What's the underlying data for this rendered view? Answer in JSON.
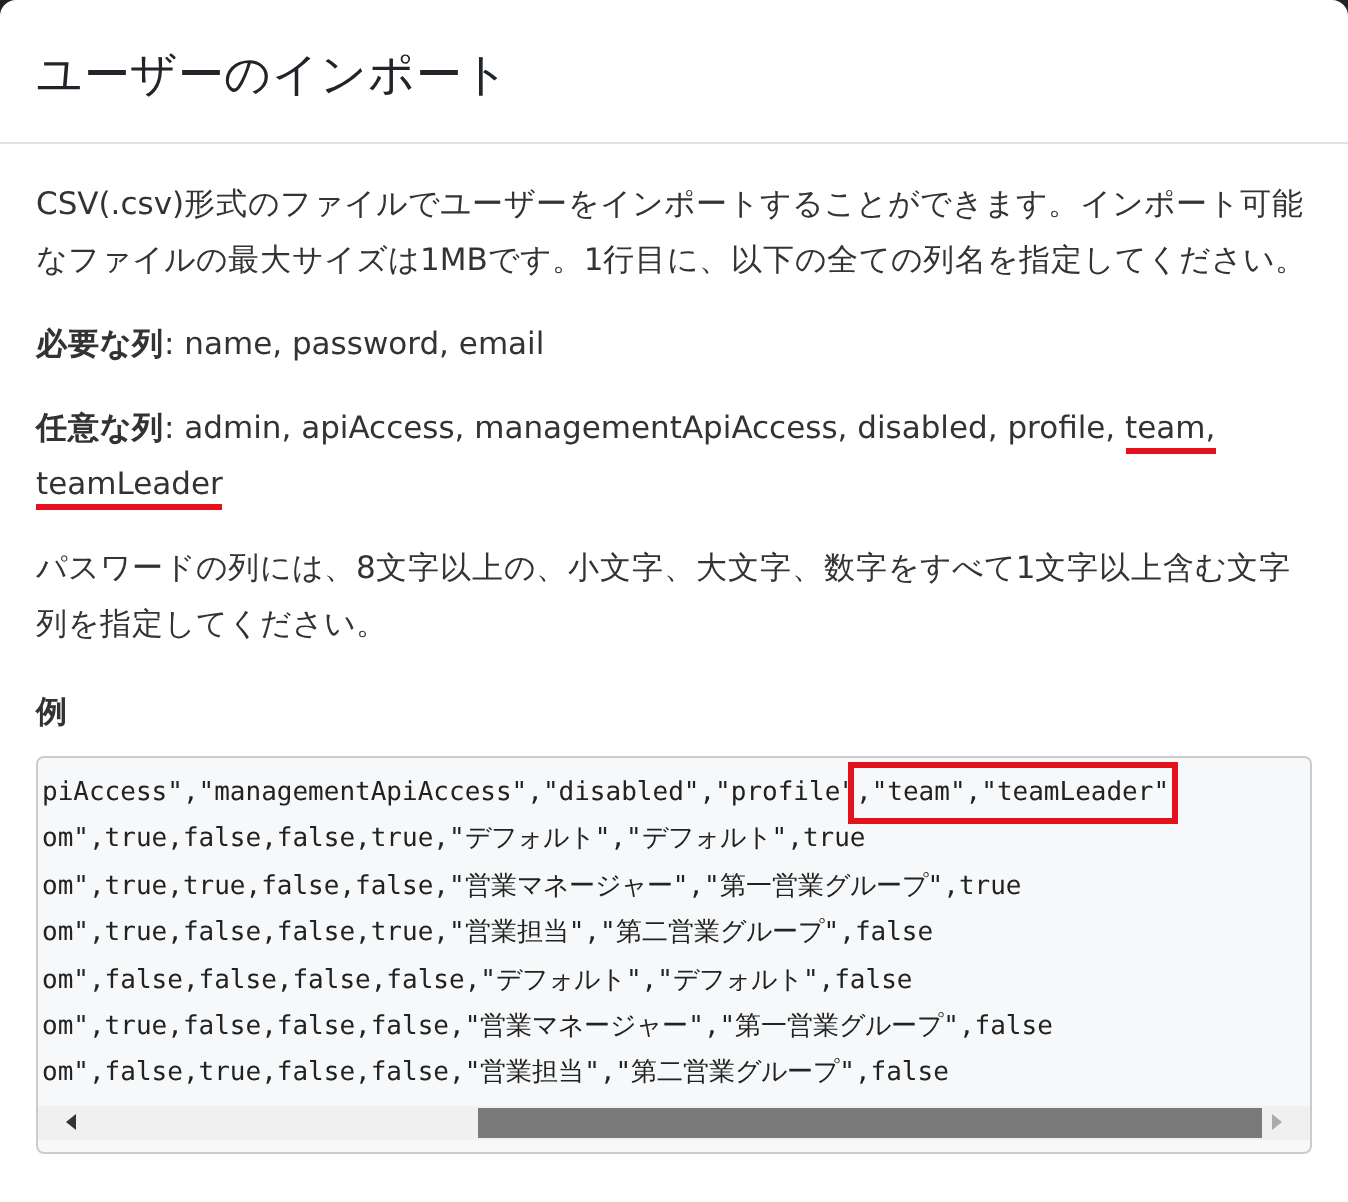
{
  "dialog": {
    "title": "ユーザーのインポート"
  },
  "intro": "CSV(.csv)形式のファイルでユーザーをインポートすることができます。インポート可能なファイルの最大サイズは1MBです。1行目に、以下の全ての列名を指定してください。",
  "required": {
    "label": "必要な列",
    "value": ": name, password, email"
  },
  "optional": {
    "label": "任意な列",
    "parts": [
      {
        "text": ": admin, apiAccess, managementApiAccess, disabled, profile, ",
        "underlined": false
      },
      {
        "text": "team,",
        "underlined": true
      },
      {
        "text": " teamLeader",
        "underlined": true
      }
    ]
  },
  "password_note": "パスワードの列には、8文字以上の、小文字、大文字、数字をすべて1文字以上含む文字列を指定してください。",
  "example": {
    "heading": "例",
    "lines": [
      {
        "text": "piAccess\",\"managementApiAccess\",\"disabled\",\"profile\"",
        "boxed": ",\"team\",\"teamLeader\""
      },
      {
        "text": "om\",true,false,false,true,\"デフォルト\",\"デフォルト\",true"
      },
      {
        "text": "om\",true,true,false,false,\"営業マネージャー\",\"第一営業グループ\",true"
      },
      {
        "text": "om\",true,false,false,true,\"営業担当\",\"第二営業グループ\",false"
      },
      {
        "text": "om\",false,false,false,false,\"デフォルト\",\"デフォルト\",false"
      },
      {
        "text": "om\",true,false,false,false,\"営業マネージャー\",\"第一営業グループ\",false"
      },
      {
        "text": "om\",false,true,false,false,\"営業担当\",\"第二営業グループ\",false"
      }
    ]
  }
}
